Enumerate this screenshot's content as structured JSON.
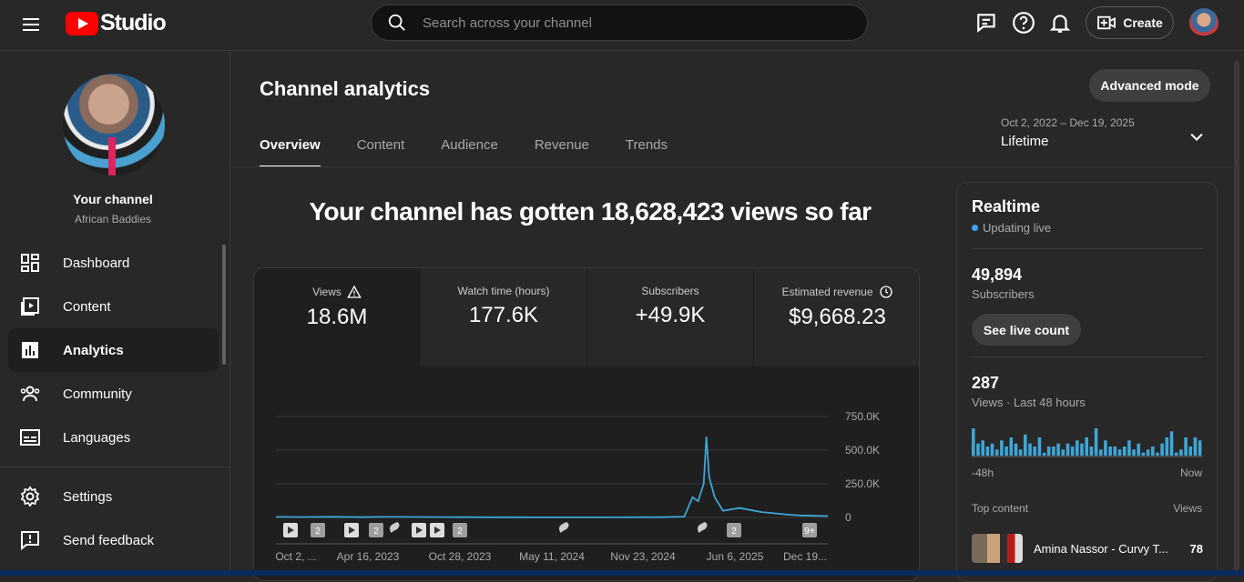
{
  "topbar": {
    "logo_text": "Studio",
    "search_placeholder": "Search across your channel",
    "create_label": "Create"
  },
  "sidebar": {
    "your_channel": "Your channel",
    "channel_name": "African Baddies",
    "items": [
      {
        "label": "Dashboard",
        "icon": "dashboard-icon"
      },
      {
        "label": "Content",
        "icon": "content-icon"
      },
      {
        "label": "Analytics",
        "icon": "analytics-icon",
        "active": true
      },
      {
        "label": "Community",
        "icon": "community-icon"
      },
      {
        "label": "Languages",
        "icon": "languages-icon"
      }
    ],
    "bottom_items": [
      {
        "label": "Settings",
        "icon": "gear-icon"
      },
      {
        "label": "Send feedback",
        "icon": "feedback-icon"
      }
    ]
  },
  "main": {
    "title": "Channel analytics",
    "advanced_mode": "Advanced mode",
    "tabs": [
      "Overview",
      "Content",
      "Audience",
      "Revenue",
      "Trends"
    ],
    "active_tab": "Overview",
    "date_range": "Oct 2, 2022 – Dec 19, 2025",
    "period": "Lifetime",
    "headline": "Your channel has gotten 18,628,423 views so far",
    "metrics": [
      {
        "label": "Views",
        "value": "18.6M"
      },
      {
        "label": "Watch time (hours)",
        "value": "177.6K"
      },
      {
        "label": "Subscribers",
        "value": "+49.9K"
      },
      {
        "label": "Estimated revenue",
        "value": "$9,668.23"
      }
    ]
  },
  "chart_data": {
    "type": "line",
    "series": [
      {
        "values_description_free": true,
        "points": [
          [
            0,
            4000
          ],
          [
            0.05,
            3000
          ],
          [
            0.1,
            5000
          ],
          [
            0.15,
            2000
          ],
          [
            0.2,
            4000
          ],
          [
            0.3,
            3000
          ],
          [
            0.4,
            1500
          ],
          [
            0.5,
            1000
          ],
          [
            0.6,
            1000
          ],
          [
            0.7,
            2000
          ],
          [
            0.74,
            6000
          ],
          [
            0.755,
            150000
          ],
          [
            0.765,
            120000
          ],
          [
            0.775,
            250000
          ],
          [
            0.78,
            600000
          ],
          [
            0.785,
            300000
          ],
          [
            0.795,
            150000
          ],
          [
            0.81,
            50000
          ],
          [
            0.84,
            70000
          ],
          [
            0.88,
            40000
          ],
          [
            0.93,
            20000
          ],
          [
            0.95,
            15000
          ],
          [
            1.0,
            10000
          ]
        ]
      }
    ],
    "x_ticks": [
      "Oct 2, ...",
      "Apr 16, 2023",
      "Oct 28, 2023",
      "May 11, 2024",
      "Nov 23, 2024",
      "Jun 6, 2025",
      "Dec 19..."
    ],
    "y_ticks": [
      "750.0K",
      "500.0K",
      "250.0K",
      "0"
    ],
    "ylim": [
      0,
      750000
    ],
    "markers": [
      "2",
      "2",
      "2",
      "2",
      "9+"
    ]
  },
  "realtime": {
    "title": "Realtime",
    "status": "Updating live",
    "subscribers_value": "49,894",
    "subscribers_label": "Subscribers",
    "see_live_count": "See live count",
    "views_value": "287",
    "views_label": "Views · Last 48 hours",
    "axis_start": "-48h",
    "axis_end": "Now",
    "top_content_label": "Top content",
    "views_col": "Views",
    "bars": [
      9,
      4,
      5,
      3,
      4,
      2,
      5,
      3,
      6,
      4,
      2,
      7,
      4,
      3,
      6,
      1,
      3,
      3,
      4,
      2,
      4,
      3,
      5,
      4,
      6,
      3,
      9,
      2,
      5,
      3,
      3,
      2,
      3,
      5,
      2,
      4,
      1,
      2,
      3,
      1,
      4,
      6,
      8,
      1,
      2,
      6,
      3,
      6,
      5
    ],
    "top_item_title": "Amina Nassor - Curvy T...",
    "top_item_views": "78"
  }
}
